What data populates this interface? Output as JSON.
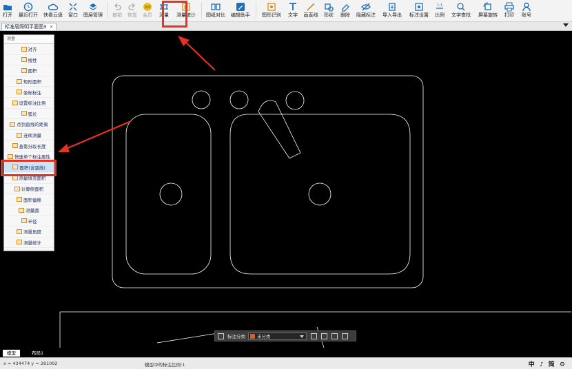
{
  "toolbar": {
    "items": [
      {
        "label": "打开",
        "icon": "folder-icon"
      },
      {
        "label": "最近打开",
        "icon": "clock-icon"
      },
      {
        "label": "快看云盘",
        "icon": "cloud-icon"
      },
      {
        "label": "窗口",
        "icon": "window-icon"
      },
      {
        "label": "图层管理",
        "icon": "layers-icon"
      },
      {
        "label": "撤销",
        "icon": "undo-icon",
        "disabled": true
      },
      {
        "label": "恢复",
        "icon": "redo-icon",
        "disabled": true
      },
      {
        "label": "会员",
        "icon": "vip-icon",
        "disabled": true
      },
      {
        "label": "测量",
        "icon": "measure-icon",
        "active": true
      },
      {
        "label": "测量统计",
        "icon": "statistics-icon"
      },
      {
        "label": "图纸对比",
        "icon": "compare-icon"
      },
      {
        "label": "编辑助手",
        "icon": "edit-assistant-icon"
      },
      {
        "label": "图形识别",
        "icon": "recognize-icon"
      },
      {
        "label": "文字",
        "icon": "text-icon"
      },
      {
        "label": "画直线",
        "icon": "line-icon"
      },
      {
        "label": "形状",
        "icon": "shape-icon"
      },
      {
        "label": "删除",
        "icon": "eraser-icon"
      },
      {
        "label": "隐藏标注",
        "icon": "hide-icon"
      },
      {
        "label": "导入导出",
        "icon": "import-export-icon"
      },
      {
        "label": "标注设置",
        "icon": "annotation-settings-icon"
      },
      {
        "label": "比例",
        "icon": "scale-icon"
      },
      {
        "label": "文字查找",
        "icon": "text-search-icon"
      },
      {
        "label": "屏幕旋转",
        "icon": "rotate-icon"
      },
      {
        "label": "打印",
        "icon": "print-icon"
      },
      {
        "label": "账号",
        "icon": "account-icon"
      }
    ]
  },
  "tabs": {
    "doc_title": "标准层照明平面图3",
    "close": "×"
  },
  "measure_panel": {
    "title": "测量",
    "items": [
      {
        "label": "对齐",
        "icon": "align-icon"
      },
      {
        "label": "线性",
        "icon": "linear-icon"
      },
      {
        "label": "面积",
        "icon": "area-icon"
      },
      {
        "label": "矩形面积",
        "icon": "rect-area-icon"
      },
      {
        "label": "坐标标注",
        "icon": "coordinate-icon"
      },
      {
        "label": "设置标注比例",
        "icon": "set-scale-icon"
      },
      {
        "label": "弧长",
        "icon": "arc-length-icon"
      },
      {
        "label": "点到直线的距离",
        "icon": "point-line-icon"
      },
      {
        "label": "连续测量",
        "icon": "continuous-icon"
      },
      {
        "label": "查看分段长度",
        "icon": "segment-icon"
      },
      {
        "label": "快速单个标注属性",
        "icon": "quick-attr-icon"
      },
      {
        "label": "面积(含弧线)",
        "icon": "arc-area-icon",
        "selected": true
      },
      {
        "label": "测量填充面积",
        "icon": "fill-area-icon"
      },
      {
        "label": "计算侧面积",
        "icon": "side-area-icon"
      },
      {
        "label": "面积偏移",
        "icon": "area-offset-icon"
      },
      {
        "label": "测量圆",
        "icon": "circle-icon"
      },
      {
        "label": "半径",
        "icon": "radius-icon"
      },
      {
        "label": "测量角度",
        "icon": "angle-icon"
      },
      {
        "label": "测量统计",
        "icon": "stats-icon"
      }
    ]
  },
  "annotation_bar": {
    "label": "标注分类",
    "category": "未分类",
    "category_color": "#e45a17"
  },
  "layout_tabs": [
    {
      "label": "模型",
      "active": true
    },
    {
      "label": "布局1",
      "active": false
    }
  ],
  "status": {
    "coords": "x = 434474  y = 281092",
    "scale_text": "模型中的标注比例:1",
    "ime": "中 ♪ 简 ⚙"
  },
  "colors": {
    "highlight": "#e8311e",
    "canvas_bg": "#000000",
    "drawing_line": "#ffffff"
  }
}
